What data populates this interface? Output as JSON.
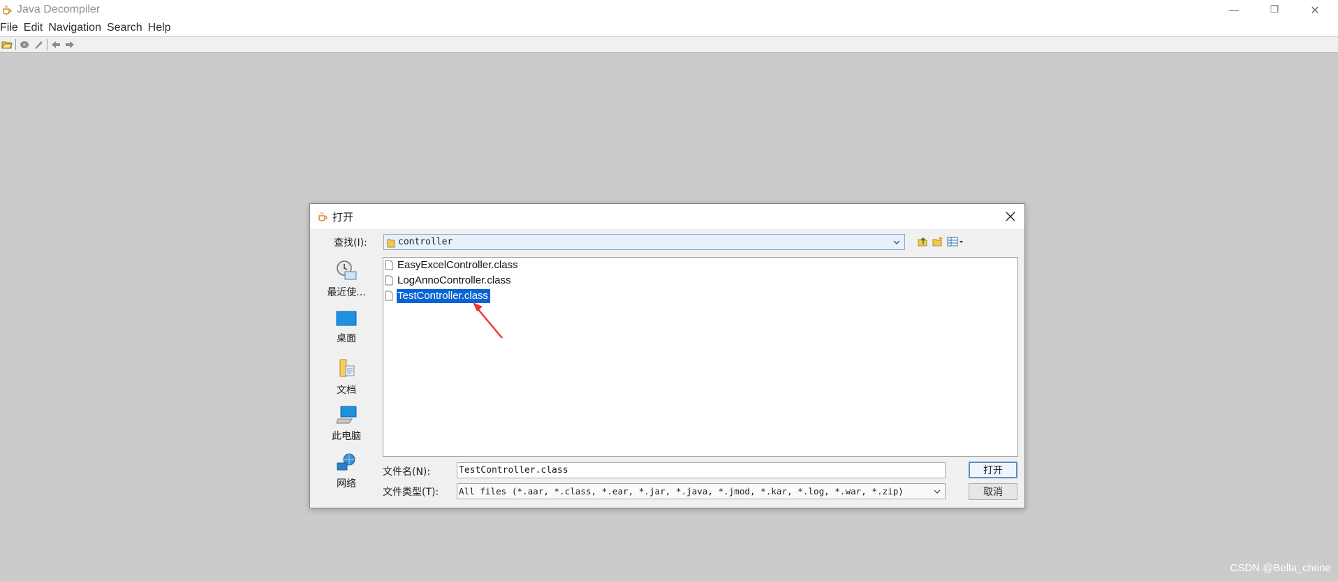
{
  "window": {
    "title": "Java Decompiler",
    "controls": {
      "minimize": "—",
      "maximize": "❐",
      "close": "✕"
    }
  },
  "menubar": {
    "items": [
      {
        "label": "File"
      },
      {
        "label": "Edit"
      },
      {
        "label": "Navigation"
      },
      {
        "label": "Search"
      },
      {
        "label": "Help"
      }
    ]
  },
  "toolbar": {
    "icons": [
      "open-folder-icon",
      "open-type-icon",
      "search-icon",
      "back-icon",
      "forward-icon"
    ]
  },
  "dialog": {
    "title": "打开",
    "look_in_label": "查找(I):",
    "look_in_value": "controller",
    "tool_icons": [
      "up-folder-icon",
      "new-folder-icon",
      "view-menu-icon"
    ],
    "places": [
      {
        "label": "最近使...",
        "icon": "recent-items-icon"
      },
      {
        "label": "桌面",
        "icon": "desktop-icon"
      },
      {
        "label": "文档",
        "icon": "documents-icon"
      },
      {
        "label": "此电脑",
        "icon": "computer-icon"
      },
      {
        "label": "网络",
        "icon": "network-icon"
      }
    ],
    "files": [
      {
        "name": "EasyExcelController.class",
        "selected": false
      },
      {
        "name": "LogAnnoController.class",
        "selected": false
      },
      {
        "name": "TestController.class",
        "selected": true
      }
    ],
    "filename_label": "文件名(N):",
    "filename_value": "TestController.class",
    "filetype_label": "文件类型(T):",
    "filetype_value": "All files (*.aar, *.class, *.ear, *.jar, *.java, *.jmod, *.kar, *.log, *.war, *.zip)",
    "open_button": "打开",
    "cancel_button": "取消"
  },
  "watermark": "CSDN @Bella_chene",
  "colors": {
    "desktop_bg": "#cbcbcb",
    "selection": "#0a64d4",
    "annotation_arrow": "#e8392e"
  }
}
